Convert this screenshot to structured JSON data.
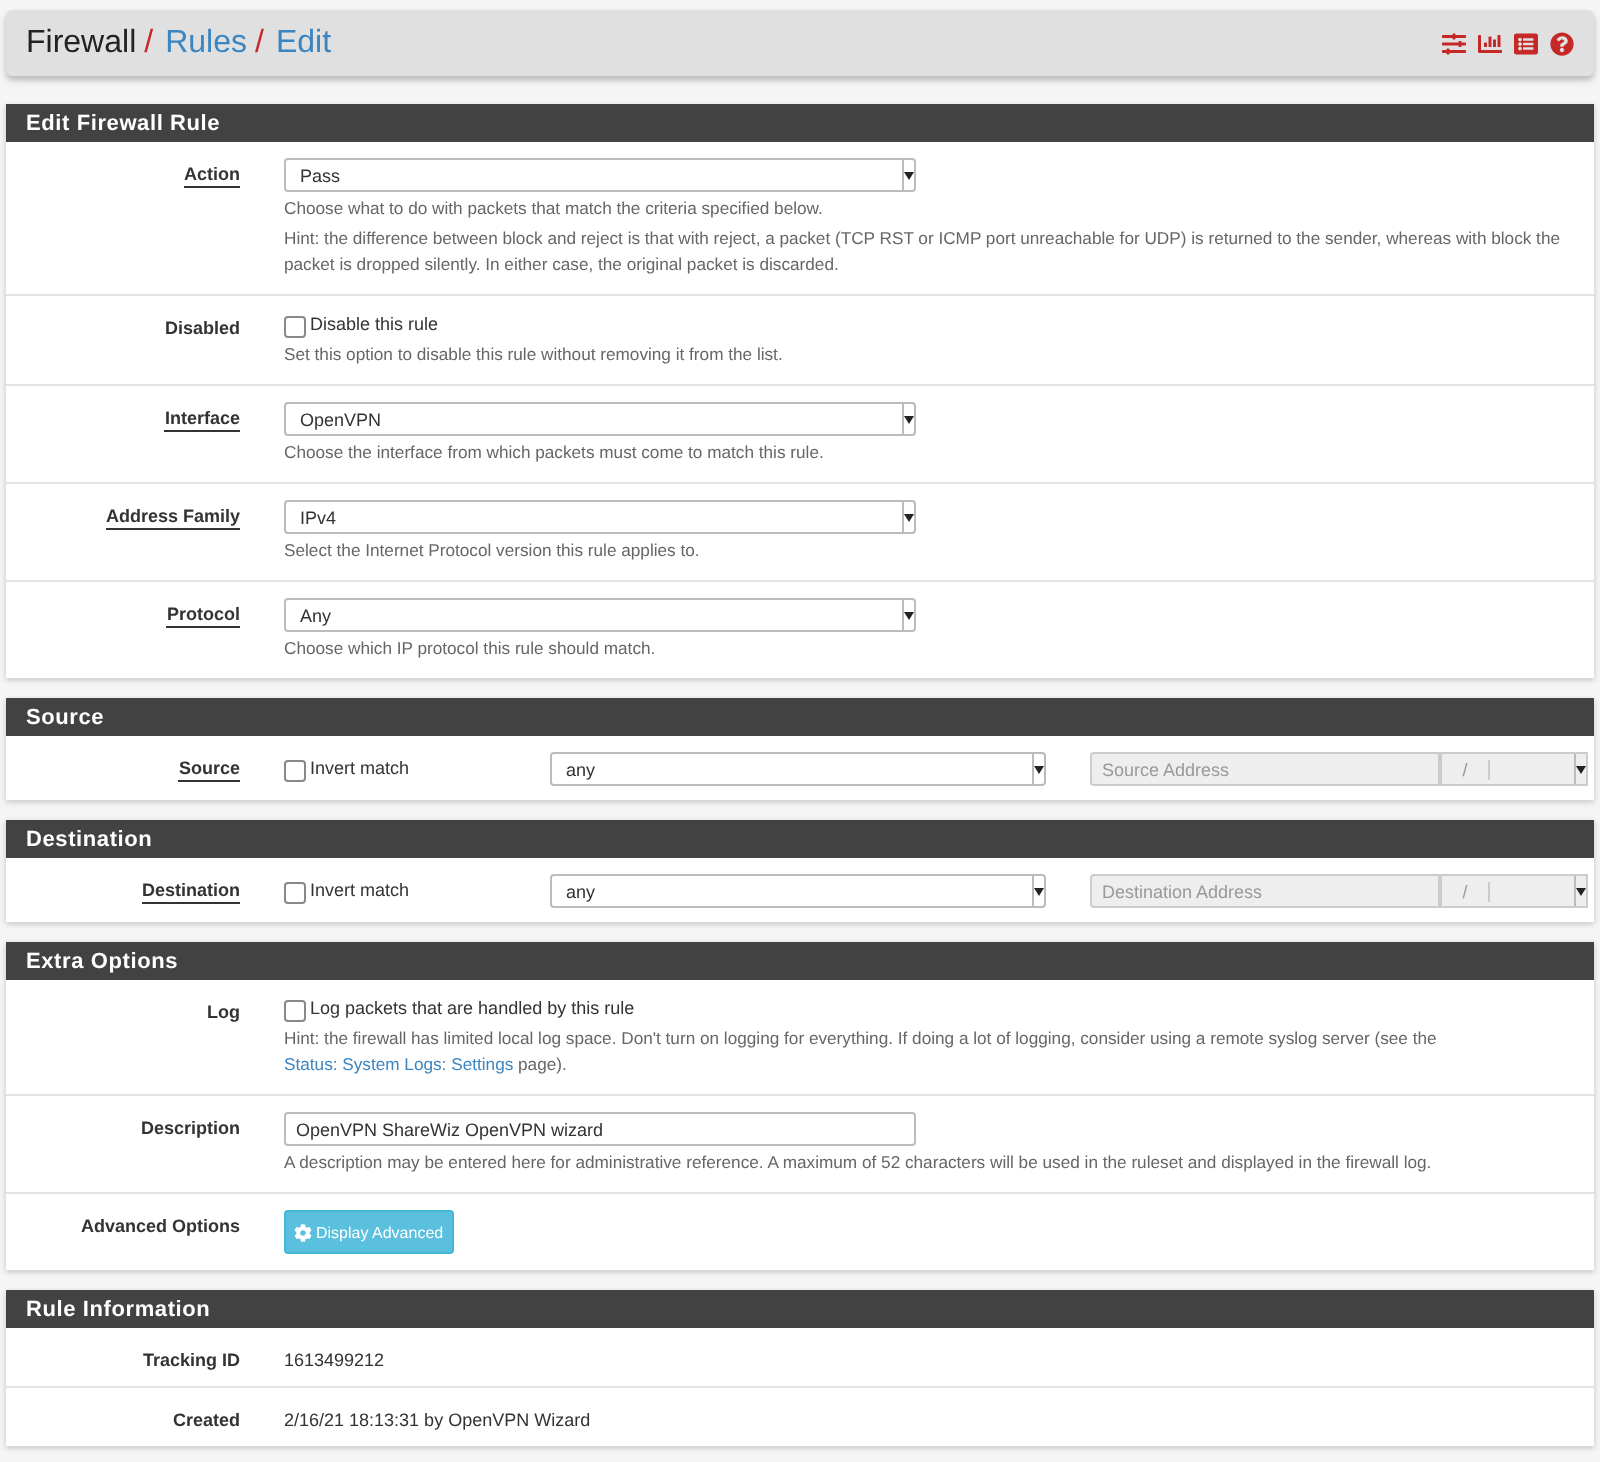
{
  "breadcrumb": [
    {
      "text": "Firewall",
      "link": false
    },
    {
      "separator": "/",
      "text": "Rules",
      "link": true
    },
    {
      "separator": "/",
      "text": "Edit",
      "link": true
    }
  ],
  "sections": [
    {
      "title": "Edit Firewall Rule",
      "rows": [
        {
          "kind": "select",
          "label": "Action",
          "label_link": true,
          "value": "Pass",
          "hints": [
            [
              {
                "text": "Choose what to do with packets that match the criteria specified below."
              }
            ],
            [
              {
                "text": "Hint: the difference between block and reject is that with reject, a packet (TCP RST or ICMP port unreachable for UDP) is returned to the sender, whereas with block the packet is dropped silently. In either case, the original packet is discarded."
              }
            ]
          ]
        },
        {
          "kind": "checkbox",
          "label": "Disabled",
          "label_link": false,
          "option": "Disable this rule",
          "checked": false,
          "hints": [
            [
              {
                "text": "Set this option to disable this rule without removing it from the list."
              }
            ]
          ]
        },
        {
          "kind": "select",
          "label": "Interface",
          "label_link": true,
          "value": "OpenVPN",
          "hints": [
            [
              {
                "text": "Choose the interface from which packets must come to match this rule."
              }
            ]
          ]
        },
        {
          "kind": "select",
          "label": "Address Family",
          "label_link": true,
          "value": "IPv4",
          "hints": [
            [
              {
                "text": "Select the Internet Protocol version this rule applies to."
              }
            ]
          ]
        },
        {
          "kind": "select",
          "label": "Protocol",
          "label_link": true,
          "value": "Any",
          "hints": [
            [
              {
                "text": "Choose which IP protocol this rule should match."
              }
            ]
          ]
        }
      ]
    },
    {
      "title": "Source",
      "rows": [
        {
          "kind": "address",
          "label": "Source",
          "label_link": true,
          "option": "Invert match",
          "checked": false,
          "value": "any",
          "placeholder": "Source Address",
          "separator": "/"
        }
      ]
    },
    {
      "title": "Destination",
      "rows": [
        {
          "kind": "address",
          "label": "Destination",
          "label_link": true,
          "option": "Invert match",
          "checked": false,
          "value": "any",
          "placeholder": "Destination Address",
          "separator": "/"
        }
      ]
    },
    {
      "title": "Extra Options",
      "rows": [
        {
          "kind": "checkbox",
          "label": "Log",
          "label_link": false,
          "option": "Log packets that are handled by this rule",
          "checked": false,
          "hints": [
            [
              {
                "text": "Hint: the firewall has limited local log space. Don't turn on logging for everything. If doing a lot of logging, consider using a remote syslog server (see the "
              },
              {
                "text": "Status: System Logs: Settings",
                "link": true
              },
              {
                "text": " page)."
              }
            ]
          ]
        },
        {
          "kind": "text",
          "label": "Description",
          "label_link": false,
          "value": "OpenVPN ShareWiz OpenVPN wizard",
          "hints": [
            [
              {
                "text": "A description may be entered here for administrative reference. A maximum of 52 characters will be used in the ruleset and displayed in the firewall log."
              }
            ]
          ]
        },
        {
          "kind": "button",
          "label": "Advanced Options",
          "label_link": false,
          "button": "Display Advanced"
        }
      ]
    },
    {
      "title": "Rule Information",
      "rows": [
        {
          "kind": "info",
          "label": "Tracking ID",
          "label_link": false,
          "value": "1613499212"
        },
        {
          "kind": "info",
          "label": "Created",
          "label_link": false,
          "value": "2/16/21 18:13:31 by OpenVPN Wizard"
        }
      ]
    }
  ]
}
